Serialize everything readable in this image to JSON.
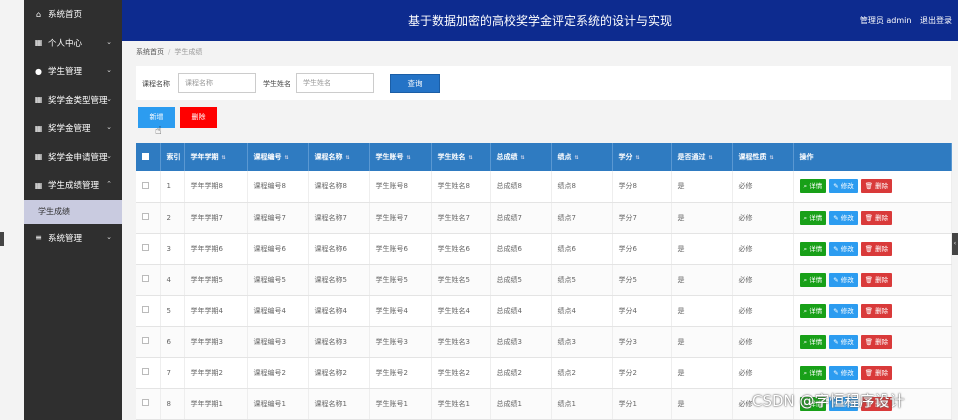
{
  "header": {
    "title": "基于数据加密的高校奖学金评定系统的设计与实现",
    "user": "管理员 admin",
    "logout": "退出登录"
  },
  "sidebar": {
    "items": [
      {
        "label": "系统首页",
        "icon": "home-icon"
      },
      {
        "label": "个人中心",
        "icon": "grid-icon"
      },
      {
        "label": "学生管理",
        "icon": "person-icon"
      },
      {
        "label": "奖学金类型管理",
        "icon": "grid-icon"
      },
      {
        "label": "奖学金管理",
        "icon": "grid-icon"
      },
      {
        "label": "奖学金申请管理",
        "icon": "grid-icon"
      },
      {
        "label": "学生成绩管理",
        "icon": "grid-icon"
      },
      {
        "label": "系统管理",
        "icon": "menu-icon"
      }
    ],
    "sub_item": "学生成绩"
  },
  "breadcrumb": {
    "home": "系统首页",
    "sep": "/",
    "current": "学生成绩"
  },
  "search": {
    "course_label": "课程名称",
    "course_placeholder": "课程名称",
    "student_label": "学生姓名",
    "student_placeholder": "学生姓名",
    "query_button": "查询"
  },
  "actions": {
    "add": "新增",
    "delete": "删除"
  },
  "table": {
    "headers": [
      "索引",
      "学年学期",
      "课程编号",
      "课程名称",
      "学生账号",
      "学生姓名",
      "总成绩",
      "绩点",
      "学分",
      "是否通过",
      "课程性质",
      "操作"
    ],
    "rows": [
      [
        "1",
        "学年学期8",
        "课程编号8",
        "课程名称8",
        "学生账号8",
        "学生姓名8",
        "总成绩8",
        "绩点8",
        "学分8",
        "是",
        "必修"
      ],
      [
        "2",
        "学年学期7",
        "课程编号7",
        "课程名称7",
        "学生账号7",
        "学生姓名7",
        "总成绩7",
        "绩点7",
        "学分7",
        "是",
        "必修"
      ],
      [
        "3",
        "学年学期6",
        "课程编号6",
        "课程名称6",
        "学生账号6",
        "学生姓名6",
        "总成绩6",
        "绩点6",
        "学分6",
        "是",
        "必修"
      ],
      [
        "4",
        "学年学期5",
        "课程编号5",
        "课程名称5",
        "学生账号5",
        "学生姓名5",
        "总成绩5",
        "绩点5",
        "学分5",
        "是",
        "必修"
      ],
      [
        "5",
        "学年学期4",
        "课程编号4",
        "课程名称4",
        "学生账号4",
        "学生姓名4",
        "总成绩4",
        "绩点4",
        "学分4",
        "是",
        "必修"
      ],
      [
        "6",
        "学年学期3",
        "课程编号3",
        "课程名称3",
        "学生账号3",
        "学生姓名3",
        "总成绩3",
        "绩点3",
        "学分3",
        "是",
        "必修"
      ],
      [
        "7",
        "学年学期2",
        "课程编号2",
        "课程名称2",
        "学生账号2",
        "学生姓名2",
        "总成绩2",
        "绩点2",
        "学分2",
        "是",
        "必修"
      ],
      [
        "8",
        "学年学期1",
        "课程编号1",
        "课程名称1",
        "学生账号1",
        "学生姓名1",
        "总成绩1",
        "绩点1",
        "学分1",
        "是",
        "必修"
      ]
    ],
    "row_actions": {
      "detail": "详情",
      "edit": "修改",
      "remove": "删除"
    }
  },
  "watermark": "CSDN @字恒程序设计",
  "colors": {
    "topbar": "#0d2b8f",
    "sidebar": "#2f2f2f",
    "table_header": "#2f7bc1",
    "detail": "#18a018",
    "edit": "#2c9cf0",
    "remove": "#d93a3a",
    "delete_button": "#ff0000"
  }
}
